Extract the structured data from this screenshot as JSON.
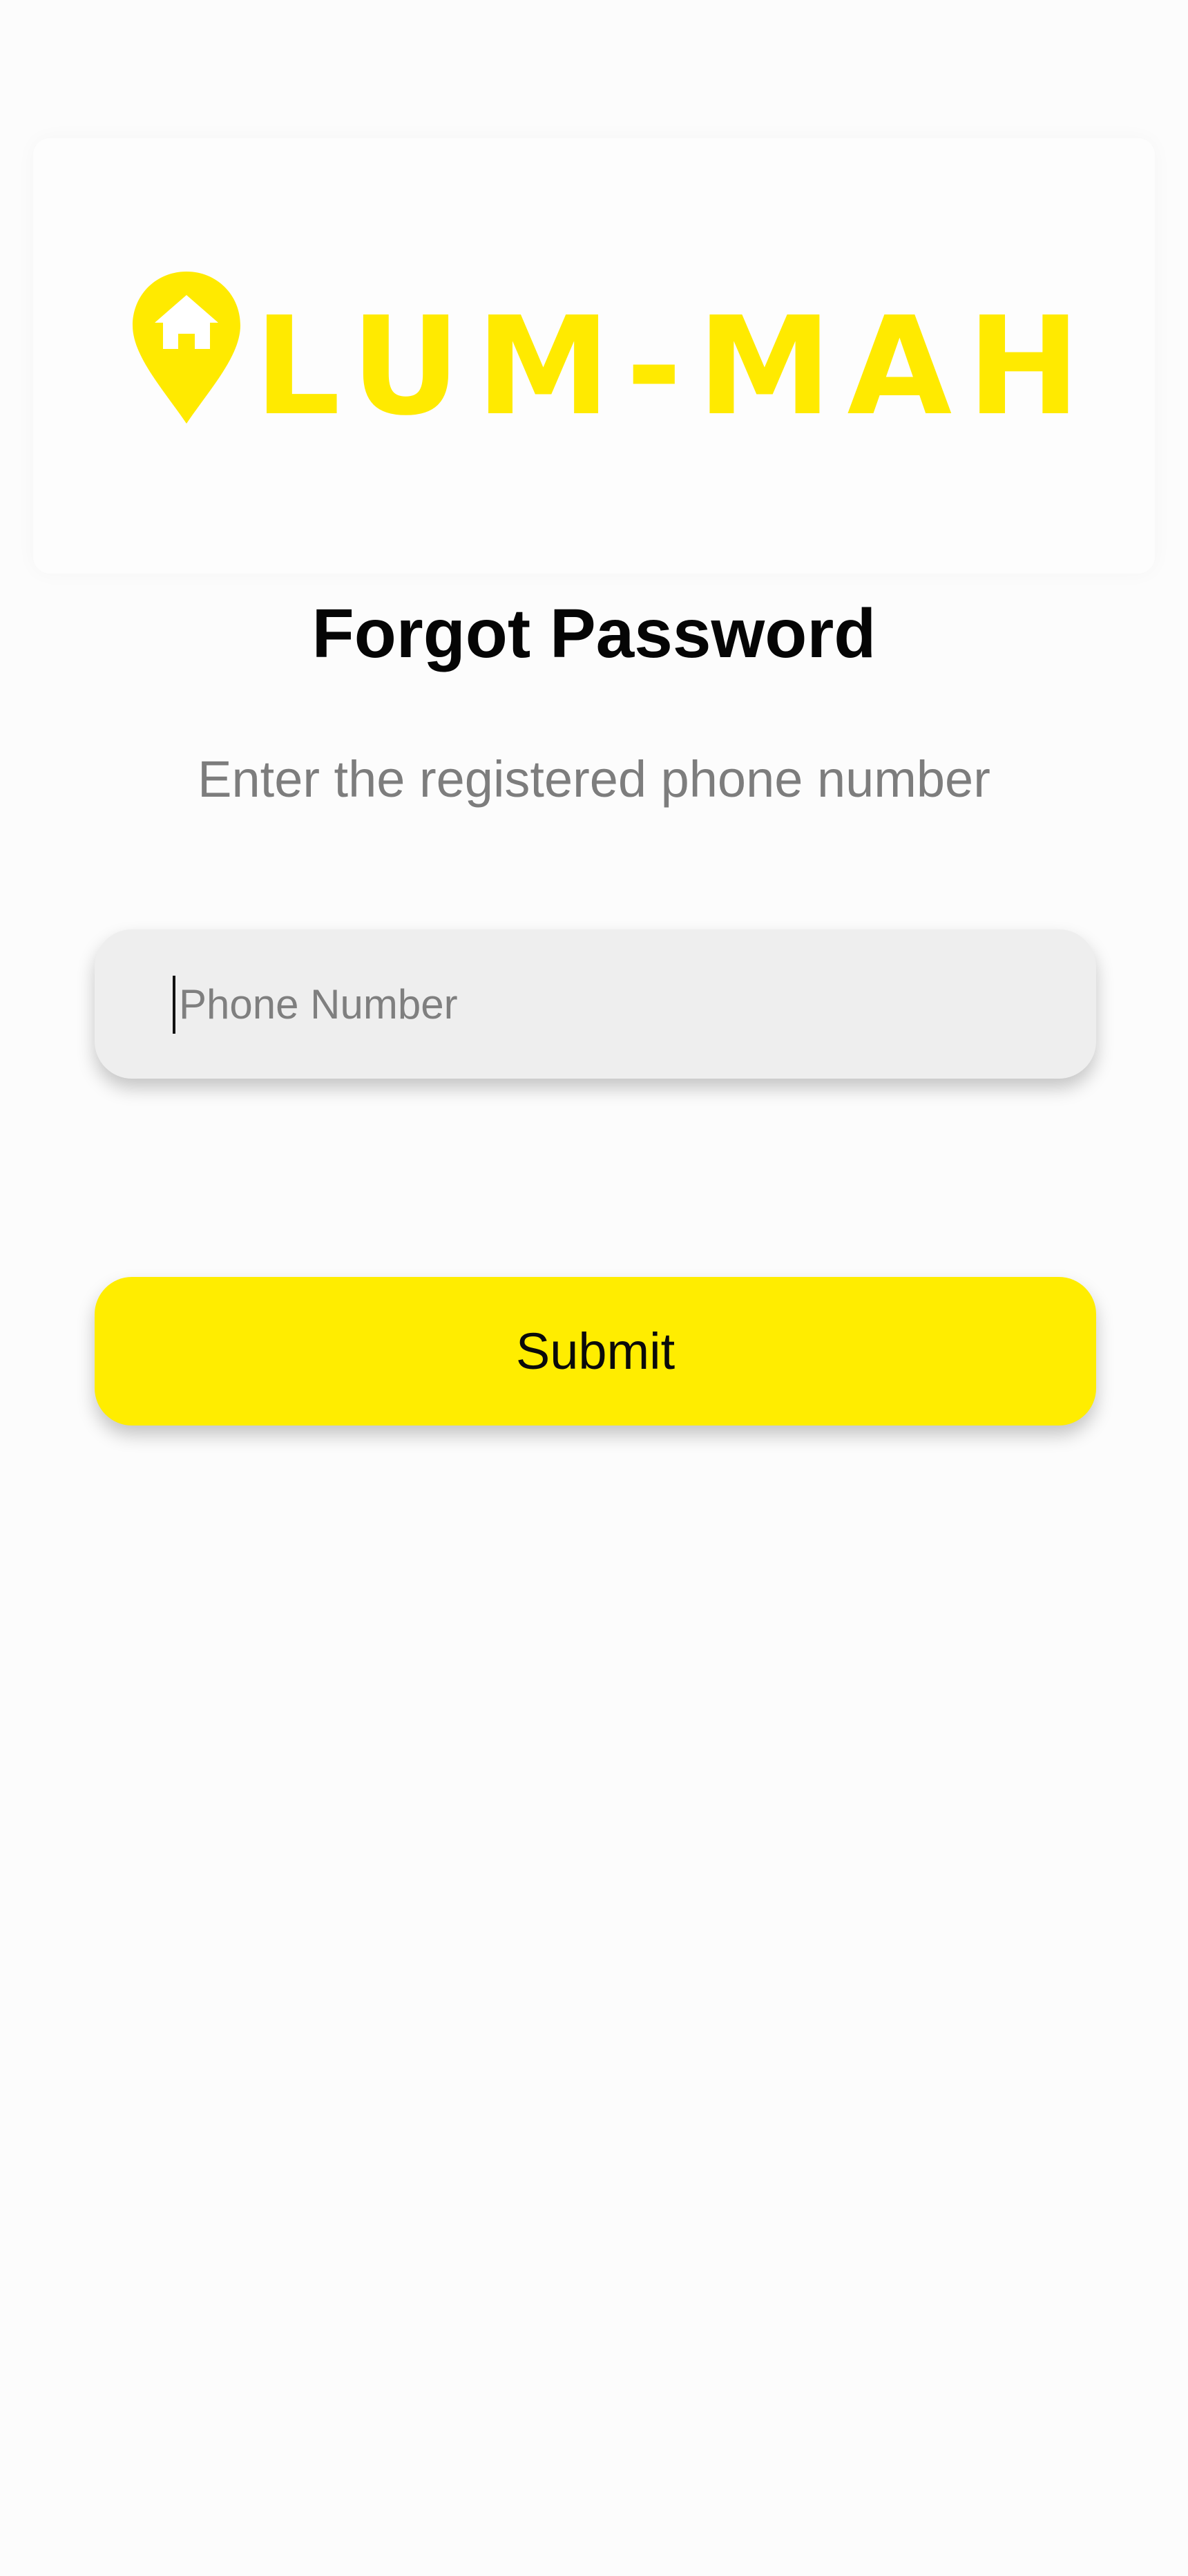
{
  "brand": {
    "name": "LUM-MAH",
    "logo_icon": "house-location-pin-icon",
    "accent_color": "#ffea00"
  },
  "page": {
    "title": "Forgot Password",
    "subtitle": "Enter the registered phone number"
  },
  "form": {
    "phone": {
      "placeholder": "Phone Number",
      "value": ""
    },
    "submit_label": "Submit"
  }
}
